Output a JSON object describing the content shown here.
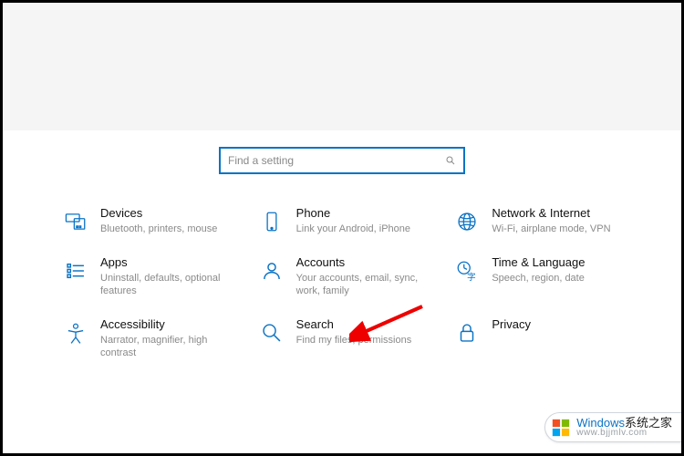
{
  "search": {
    "placeholder": "Find a setting"
  },
  "categories": [
    {
      "title": "Devices",
      "desc": "Bluetooth, printers, mouse"
    },
    {
      "title": "Phone",
      "desc": "Link your Android, iPhone"
    },
    {
      "title": "Network & Internet",
      "desc": "Wi-Fi, airplane mode, VPN"
    },
    {
      "title": "Apps",
      "desc": "Uninstall, defaults, optional features"
    },
    {
      "title": "Accounts",
      "desc": "Your accounts, email, sync, work, family"
    },
    {
      "title": "Time & Language",
      "desc": "Speech, region, date"
    },
    {
      "title": "Accessibility",
      "desc": "Narrator, magnifier, high contrast"
    },
    {
      "title": "Search",
      "desc": "Find my files, permissions"
    },
    {
      "title": "Privacy",
      "desc": ""
    }
  ],
  "watermark": {
    "brand": "Windows",
    "suffix": "系统之家",
    "url": "www.bjjmlv.com"
  }
}
